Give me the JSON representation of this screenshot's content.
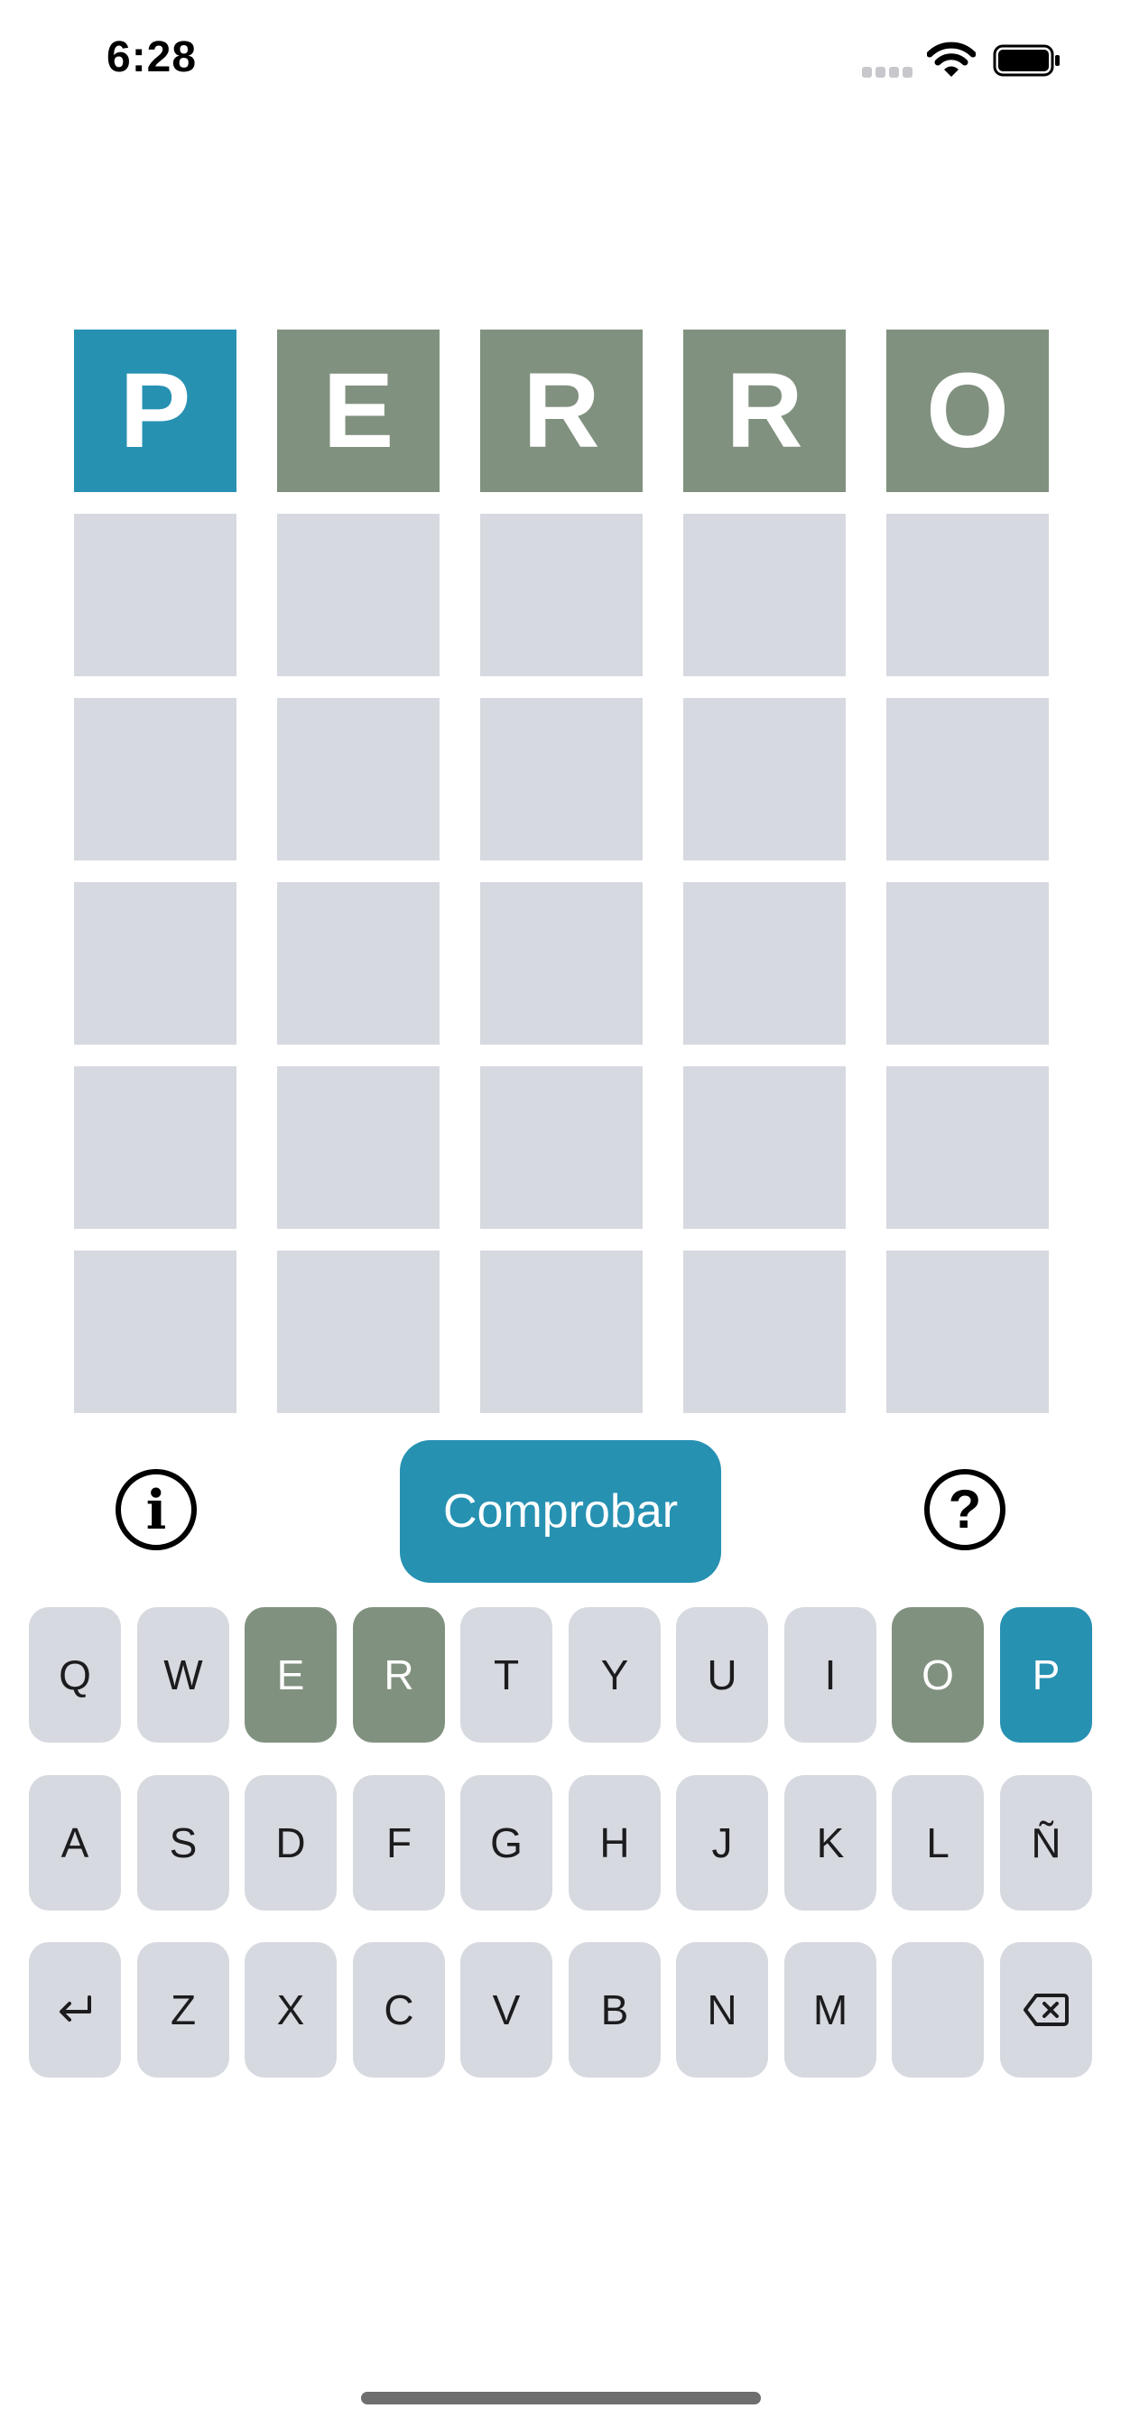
{
  "status_bar": {
    "time": "6:28",
    "signal_icon": "cellular-signal-icon",
    "wifi_icon": "wifi-icon",
    "battery_icon": "battery-full-icon"
  },
  "colors": {
    "correct": "#2791b2",
    "present": "#81917f",
    "empty": "#d6d9df",
    "key_text": "#1c1c1e"
  },
  "board": {
    "rows": [
      [
        {
          "letter": "P",
          "state": "correct"
        },
        {
          "letter": "E",
          "state": "present"
        },
        {
          "letter": "R",
          "state": "present"
        },
        {
          "letter": "R",
          "state": "present"
        },
        {
          "letter": "O",
          "state": "present"
        }
      ],
      [
        {
          "letter": "",
          "state": "empty"
        },
        {
          "letter": "",
          "state": "empty"
        },
        {
          "letter": "",
          "state": "empty"
        },
        {
          "letter": "",
          "state": "empty"
        },
        {
          "letter": "",
          "state": "empty"
        }
      ],
      [
        {
          "letter": "",
          "state": "empty"
        },
        {
          "letter": "",
          "state": "empty"
        },
        {
          "letter": "",
          "state": "empty"
        },
        {
          "letter": "",
          "state": "empty"
        },
        {
          "letter": "",
          "state": "empty"
        }
      ],
      [
        {
          "letter": "",
          "state": "empty"
        },
        {
          "letter": "",
          "state": "empty"
        },
        {
          "letter": "",
          "state": "empty"
        },
        {
          "letter": "",
          "state": "empty"
        },
        {
          "letter": "",
          "state": "empty"
        }
      ],
      [
        {
          "letter": "",
          "state": "empty"
        },
        {
          "letter": "",
          "state": "empty"
        },
        {
          "letter": "",
          "state": "empty"
        },
        {
          "letter": "",
          "state": "empty"
        },
        {
          "letter": "",
          "state": "empty"
        }
      ],
      [
        {
          "letter": "",
          "state": "empty"
        },
        {
          "letter": "",
          "state": "empty"
        },
        {
          "letter": "",
          "state": "empty"
        },
        {
          "letter": "",
          "state": "empty"
        },
        {
          "letter": "",
          "state": "empty"
        }
      ]
    ]
  },
  "actions": {
    "info_icon": "info-icon",
    "help_icon": "help-icon",
    "check_label": "Comprobar"
  },
  "keyboard": {
    "rows": [
      [
        {
          "label": "Q",
          "state": "empty"
        },
        {
          "label": "W",
          "state": "empty"
        },
        {
          "label": "E",
          "state": "present"
        },
        {
          "label": "R",
          "state": "present"
        },
        {
          "label": "T",
          "state": "empty"
        },
        {
          "label": "Y",
          "state": "empty"
        },
        {
          "label": "U",
          "state": "empty"
        },
        {
          "label": "I",
          "state": "empty"
        },
        {
          "label": "O",
          "state": "present"
        },
        {
          "label": "P",
          "state": "correct"
        }
      ],
      [
        {
          "label": "A",
          "state": "empty"
        },
        {
          "label": "S",
          "state": "empty"
        },
        {
          "label": "D",
          "state": "empty"
        },
        {
          "label": "F",
          "state": "empty"
        },
        {
          "label": "G",
          "state": "empty"
        },
        {
          "label": "H",
          "state": "empty"
        },
        {
          "label": "J",
          "state": "empty"
        },
        {
          "label": "K",
          "state": "empty"
        },
        {
          "label": "L",
          "state": "empty"
        },
        {
          "label": "Ñ",
          "state": "empty"
        }
      ],
      [
        {
          "label": "",
          "icon": "return-icon",
          "state": "empty"
        },
        {
          "label": "Z",
          "state": "empty"
        },
        {
          "label": "X",
          "state": "empty"
        },
        {
          "label": "C",
          "state": "empty"
        },
        {
          "label": "V",
          "state": "empty"
        },
        {
          "label": "B",
          "state": "empty"
        },
        {
          "label": "N",
          "state": "empty"
        },
        {
          "label": "M",
          "state": "empty"
        },
        {
          "label": "",
          "state": "empty"
        },
        {
          "label": "",
          "icon": "delete-icon",
          "state": "empty"
        }
      ]
    ]
  }
}
